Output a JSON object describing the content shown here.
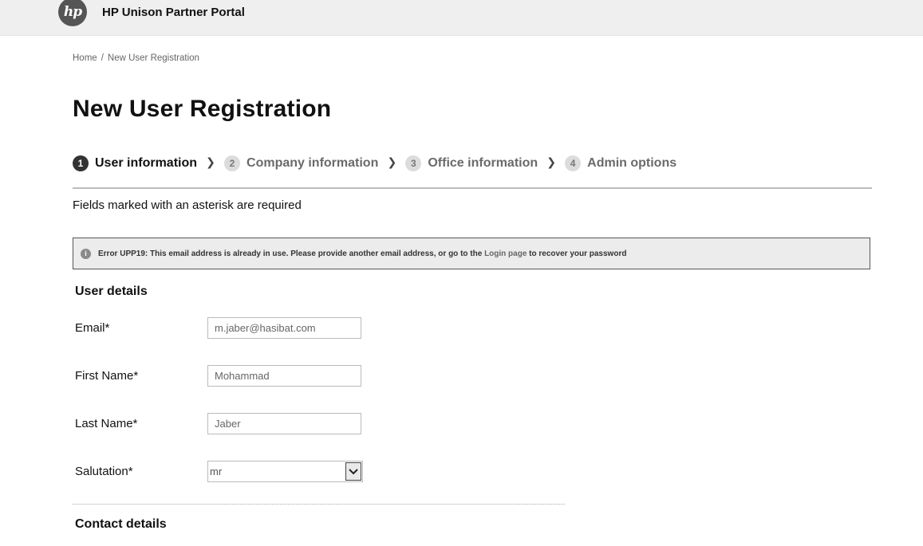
{
  "header": {
    "logo_text": "hp",
    "portal_title": "HP Unison Partner Portal"
  },
  "breadcrumb": {
    "home": "Home",
    "separator": "/",
    "current": "New User Registration"
  },
  "page_title": "New User Registration",
  "steps": [
    {
      "num": "1",
      "label": "User information",
      "active": true
    },
    {
      "num": "2",
      "label": "Company information",
      "active": false
    },
    {
      "num": "3",
      "label": "Office information",
      "active": false
    },
    {
      "num": "4",
      "label": "Admin options",
      "active": false
    }
  ],
  "required_note": "Fields marked with an asterisk are required",
  "error": {
    "icon": "info-icon",
    "text_before": "Error UPP19: This email address is already in use. Please provide another email address, or go to the ",
    "link_text": "Login page",
    "text_after": " to recover your password"
  },
  "user_details": {
    "title": "User details",
    "email_label": "Email*",
    "email_value": "m.jaber@hasibat.com",
    "first_name_label": "First Name*",
    "first_name_value": "Mohammad",
    "last_name_label": "Last Name*",
    "last_name_value": "Jaber",
    "salutation_label": "Salutation*",
    "salutation_value": "mr"
  },
  "contact_details": {
    "title": "Contact details"
  }
}
